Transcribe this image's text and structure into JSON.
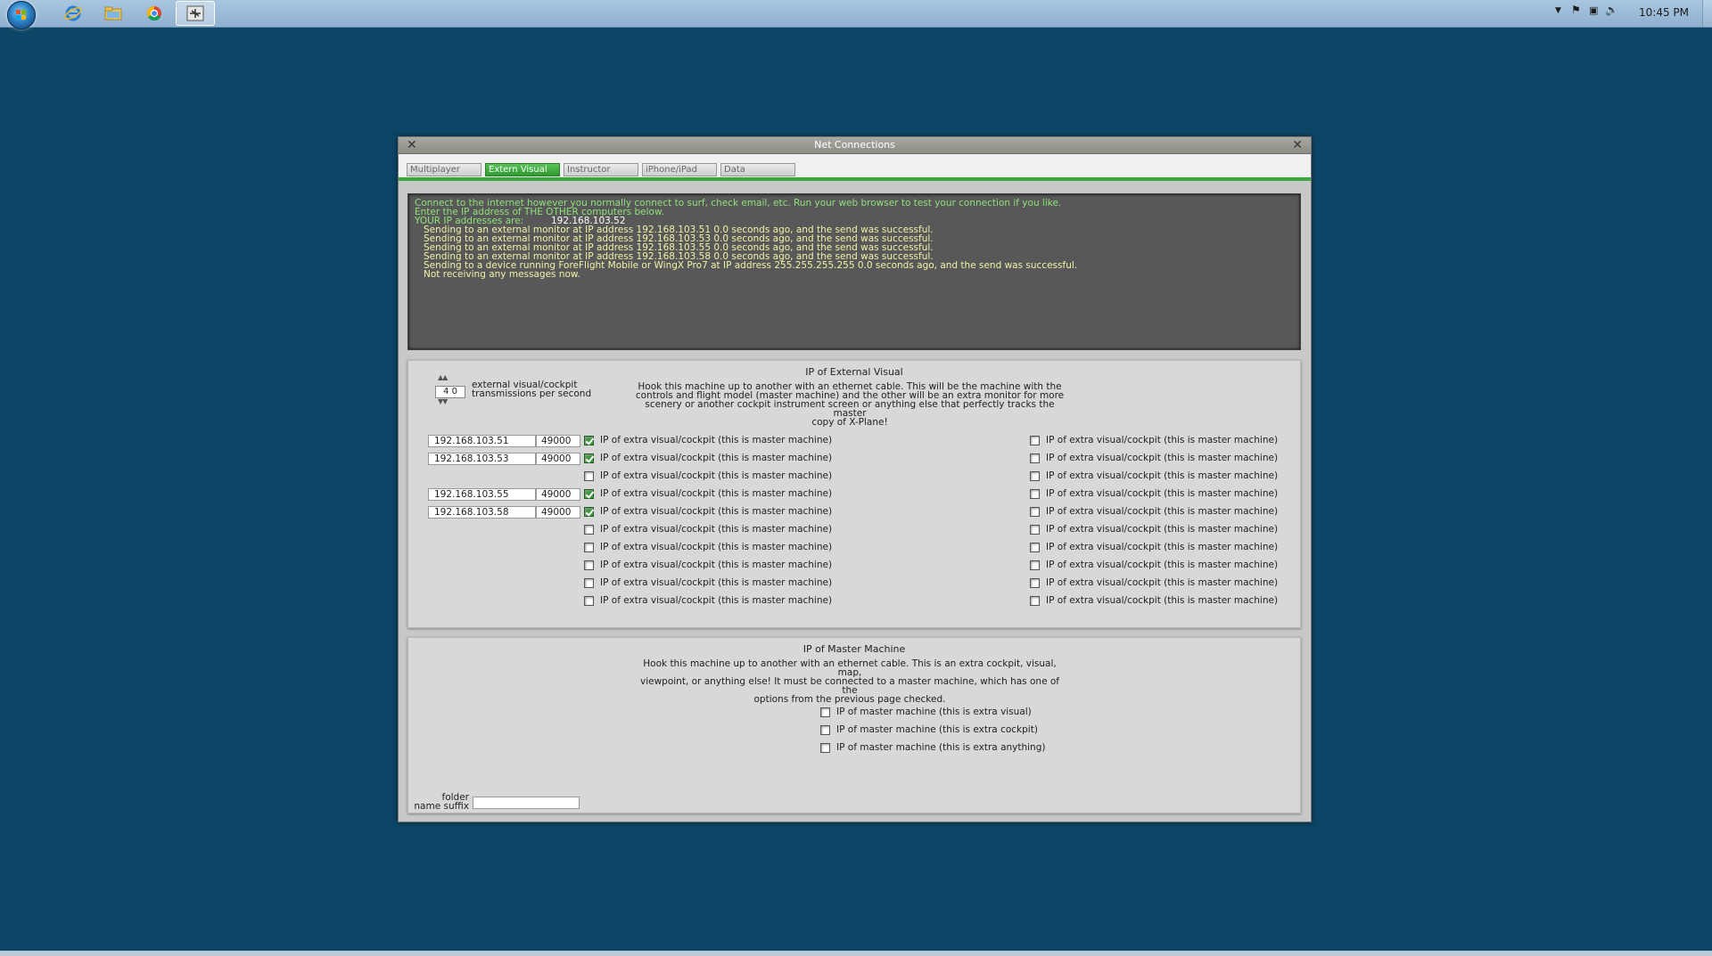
{
  "taskbar": {
    "icons": [
      "windows-start-orb",
      "internet-explorer-icon",
      "file-explorer-icon",
      "chrome-icon",
      "xplane-icon"
    ],
    "clock": "10:45 PM"
  },
  "window": {
    "title": "Net Connections",
    "tabs": [
      {
        "label": "Multiplayer",
        "active": false
      },
      {
        "label": "Extern Visual",
        "active": true
      },
      {
        "label": "Instructor",
        "active": false
      },
      {
        "label": "iPhone/iPad",
        "active": false
      },
      {
        "label": "Data",
        "active": false
      }
    ]
  },
  "console": {
    "line1": "Connect to the internet however you normally connect to surf, check email, etc. Run your web browser to test your connection if you like.",
    "line2": "Enter the IP address of THE OTHER computers below.",
    "ip_label": "YOUR IP addresses are:",
    "ip_value": "192.168.103.52",
    "status_lines": [
      "Sending to  an external monitor at IP address 192.168.103.51  0.0 seconds ago,  and the send was successful.",
      "Sending to  an external monitor at IP address 192.168.103.53  0.0 seconds ago,  and the send was successful.",
      "Sending to  an external monitor at IP address 192.168.103.55  0.0 seconds ago,  and the send was successful.",
      "Sending to  an external monitor at IP address 192.168.103.58  0.0 seconds ago,  and the send was successful.",
      "Sending to  a device running ForeFlight Mobile or WingX Pro7 at IP address 255.255.255.255  0.0 seconds ago,  and the send was successful.",
      "Not receiving any messages now."
    ]
  },
  "external_visual": {
    "title": "IP of External Visual",
    "rate_value": "4 0",
    "rate_label_1": "external visual/cockpit",
    "rate_label_2": "transmissions per second",
    "description": [
      "Hook this machine up to another with an ethernet cable. This will be the machine with the",
      "controls and flight model (master machine) and the other will be an extra monitor for more",
      "scenery or another cockpit instrument screen or anything else that perfectly tracks the master",
      "copy of X-Plane!"
    ],
    "checkbox_label": "IP of extra visual/cockpit (this is master machine)",
    "left_rows": [
      {
        "ip": "192.168.103.51",
        "port": "49000",
        "checked": true
      },
      {
        "ip": "192.168.103.53",
        "port": "49000",
        "checked": true
      },
      {
        "ip": "",
        "port": "",
        "checked": false
      },
      {
        "ip": "192.168.103.55",
        "port": "49000",
        "checked": true
      },
      {
        "ip": "192.168.103.58",
        "port": "49000",
        "checked": true
      },
      {
        "ip": "",
        "port": "",
        "checked": false
      },
      {
        "ip": "",
        "port": "",
        "checked": false
      },
      {
        "ip": "",
        "port": "",
        "checked": false
      },
      {
        "ip": "",
        "port": "",
        "checked": false
      },
      {
        "ip": "",
        "port": "",
        "checked": false
      }
    ],
    "right_rows": [
      false,
      false,
      false,
      false,
      false,
      false,
      false,
      false,
      false,
      false
    ]
  },
  "master": {
    "title": "IP of Master Machine",
    "description": [
      "Hook this machine up to another with an ethernet cable. This is an extra cockpit, visual, map,",
      "viewpoint, or anything else! It must be connected to a master machine, which has one of the",
      "options from the previous page checked."
    ],
    "options": [
      {
        "label": "IP of master machine (this is extra visual)",
        "checked": false
      },
      {
        "label": "IP of master machine (this is extra cockpit)",
        "checked": false
      },
      {
        "label": "IP of master machine (this is extra anything)",
        "checked": false
      }
    ],
    "folder_label_1": "folder",
    "folder_label_2": "name suffix",
    "folder_value": ""
  }
}
